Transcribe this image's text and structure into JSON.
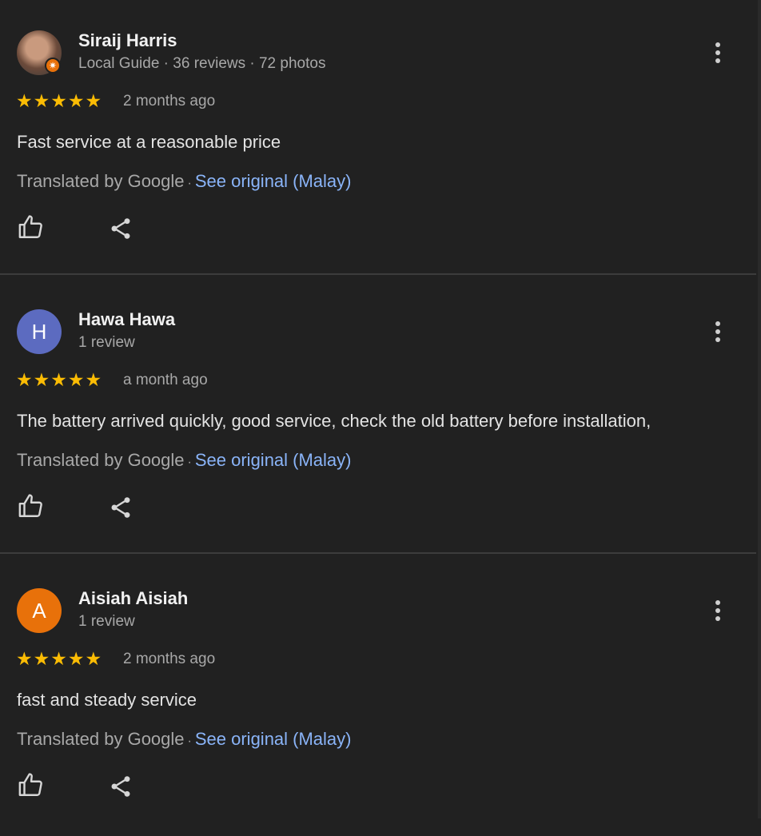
{
  "reviews": [
    {
      "name": "Siraij Harris",
      "meta": "Local Guide · 36 reviews · 72 photos",
      "avatar": {
        "type": "photo",
        "letter": ""
      },
      "rating": 5,
      "stars": "★★★★★",
      "date": "2 months ago",
      "text": "Fast service at a reasonable price",
      "translated_by": "Translated by Google",
      "see_original": "See original (Malay)"
    },
    {
      "name": "Hawa Hawa",
      "meta": "1 review",
      "avatar": {
        "type": "letter",
        "letter": "H",
        "color": "#5c6bc0"
      },
      "rating": 5,
      "stars": "★★★★★",
      "date": "a month ago",
      "text": "The battery arrived quickly, good service, check the old battery before installation,",
      "translated_by": "Translated by Google",
      "see_original": "See original (Malay)"
    },
    {
      "name": "Aisiah Aisiah",
      "meta": "1 review",
      "avatar": {
        "type": "letter",
        "letter": "A",
        "color": "#e8710a"
      },
      "rating": 5,
      "stars": "★★★★★",
      "date": "2 months ago",
      "text": "fast and steady service",
      "translated_by": "Translated by Google",
      "see_original": "See original (Malay)"
    }
  ],
  "icons": {
    "more": "more-vert-icon",
    "like": "thumbs-up-icon",
    "share": "share-icon",
    "badge": "local-guide-badge-icon"
  },
  "colors": {
    "background": "#212121",
    "star": "#fbbc04",
    "link": "#8ab4f8",
    "muted": "#a8a8a8"
  }
}
